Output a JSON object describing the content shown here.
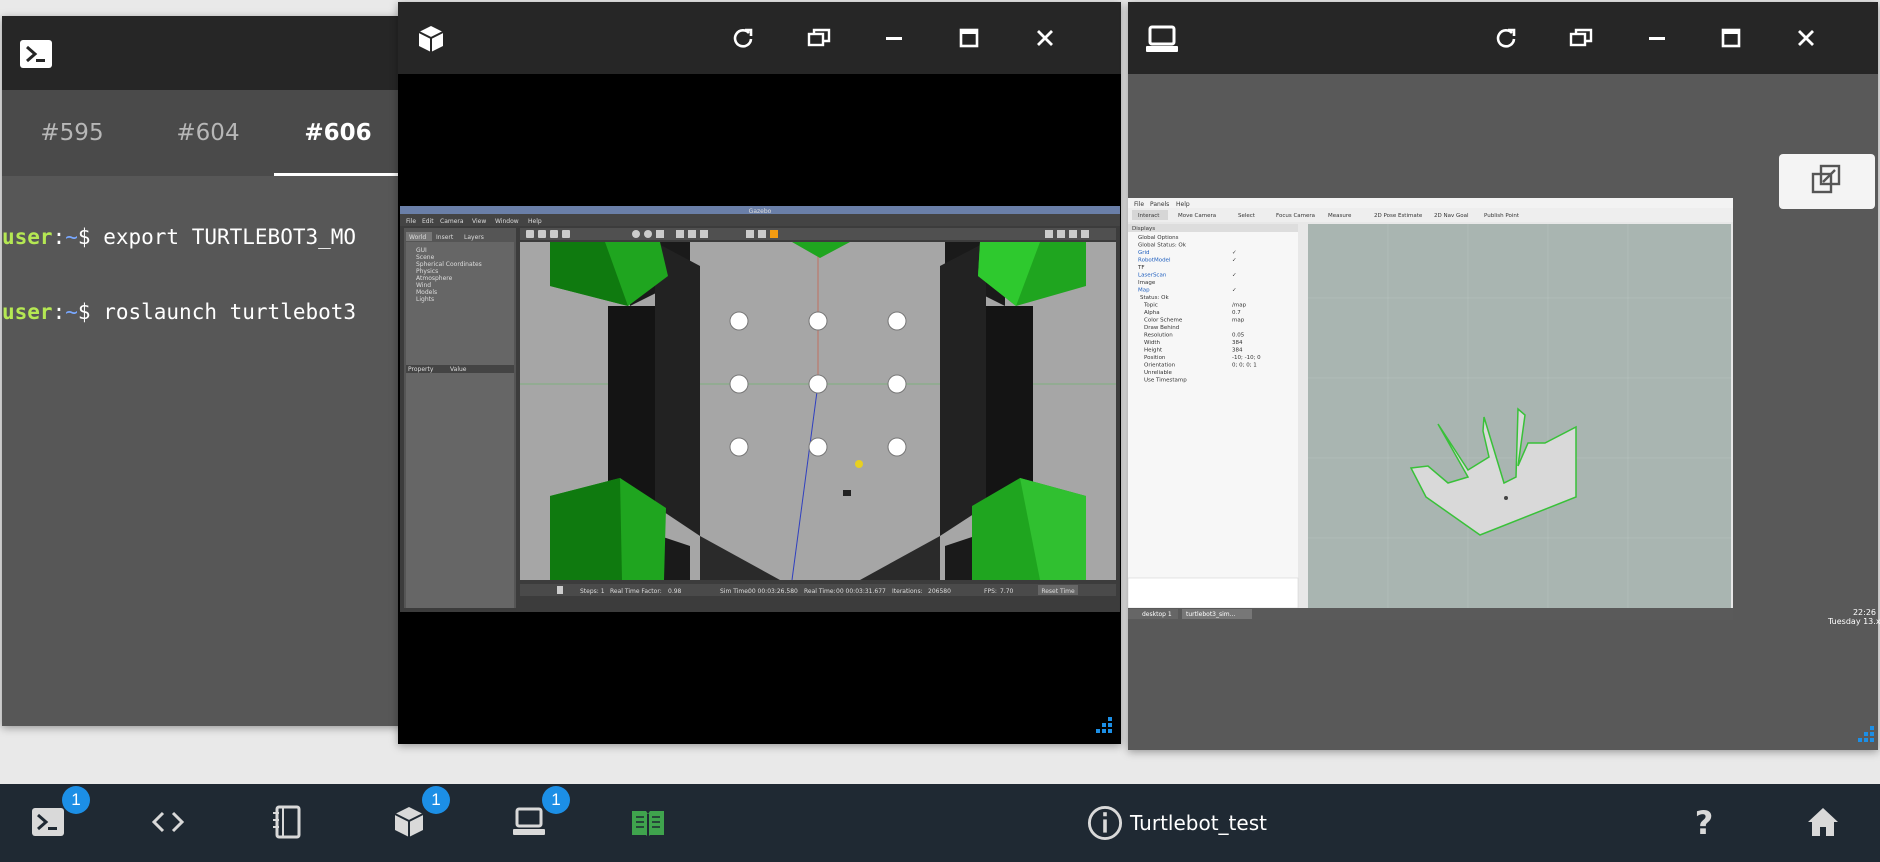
{
  "terminal": {
    "tabs": [
      "#595",
      "#604",
      "#606"
    ],
    "active_tab": "#606",
    "lines": [
      {
        "user": "user",
        "sep": ":",
        "path": "~",
        "prompt": "$ ",
        "cmd": "export TURTLEBOT3_MO"
      },
      {
        "user": "user",
        "sep": ":",
        "path": "~",
        "prompt": "$ ",
        "cmd": "roslaunch turtlebot3"
      }
    ]
  },
  "gazebo": {
    "title": "Gazebo",
    "menu": [
      "File",
      "Edit",
      "Camera",
      "View",
      "Window",
      "Help"
    ],
    "side_tabs": [
      "World",
      "Insert",
      "Layers"
    ],
    "tree": [
      "GUI",
      "Scene",
      "Spherical Coordinates",
      "Physics",
      "Atmosphere",
      "Wind",
      "Models",
      "Lights"
    ],
    "prop_headers": [
      "Property",
      "Value"
    ],
    "status": {
      "steps": "Steps: 1",
      "rtf_label": "Real Time Factor:",
      "rtf": "0.98",
      "sim_label": "Sim Time:",
      "sim": "00 00:03:26.580",
      "real_label": "Real Time:",
      "real": "00 00:03:31.677",
      "iter_label": "Iterations:",
      "iter": "206580",
      "fps_label": "FPS:",
      "fps": "7.70",
      "reset": "Reset Time"
    }
  },
  "rviz": {
    "menu": [
      "File",
      "Panels",
      "Help"
    ],
    "toolbar": [
      "Interact",
      "Move Camera",
      "Select",
      "Focus Camera",
      "Measure",
      "2D Pose Estimate",
      "2D Nav Goal",
      "Publish Point"
    ],
    "panel_title": "Displays",
    "displays": [
      {
        "name": "Global Options",
        "value": ""
      },
      {
        "name": "Global Status: Ok",
        "value": ""
      },
      {
        "name": "Grid",
        "value": "✓"
      },
      {
        "name": "RobotModel",
        "value": "✓"
      },
      {
        "name": "TF",
        "value": ""
      },
      {
        "name": "LaserScan",
        "value": "✓"
      },
      {
        "name": "Image",
        "value": ""
      },
      {
        "name": "Map",
        "value": "✓"
      },
      {
        "name": "Status: Ok",
        "value": ""
      },
      {
        "name": "Topic",
        "value": "/map"
      },
      {
        "name": "Alpha",
        "value": "0.7"
      },
      {
        "name": "Color Scheme",
        "value": "map"
      },
      {
        "name": "Draw Behind",
        "value": ""
      },
      {
        "name": "Resolution",
        "value": "0.05"
      },
      {
        "name": "Width",
        "value": "384"
      },
      {
        "name": "Height",
        "value": "384"
      },
      {
        "name": "Position",
        "value": "-10; -10; 0"
      },
      {
        "name": "Orientation",
        "value": "0; 0; 0; 1"
      },
      {
        "name": "Unreliable",
        "value": ""
      },
      {
        "name": "Use Timestamp",
        "value": ""
      }
    ],
    "taskbar_desktop": "desktop 1",
    "taskbar_app": "turtlebot3_sim...",
    "clock_time": "22:26",
    "clock_date": "Tuesday 13.xx"
  },
  "taskbar": {
    "badges": [
      "1",
      "1",
      "1"
    ],
    "project_name": "Turtlebot_test"
  },
  "colors": {
    "accent": "#1c8fe6",
    "terminal_user": "#b5e853",
    "taskbar": "#1f2933",
    "titlebar": "#262626",
    "green_book": "#3fa34d"
  }
}
